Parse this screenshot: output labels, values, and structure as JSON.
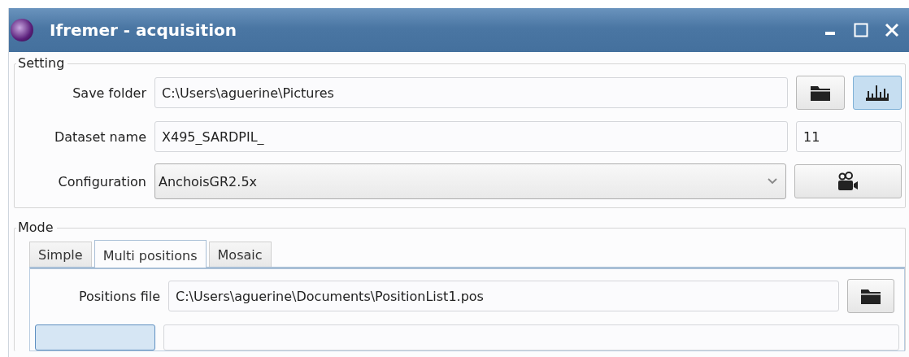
{
  "window": {
    "title": "Ifremer - acquisition"
  },
  "setting": {
    "label": "Setting",
    "rows": [
      {
        "kind": "folder",
        "label": "Save folder",
        "value": "C:\\Users\\aguerine\\Pictures",
        "toggle_checked": true
      },
      {
        "kind": "counter",
        "label": "Dataset name",
        "value": "X495_SARDPIL_",
        "count": "11"
      },
      {
        "kind": "combo",
        "label": "Configuration",
        "value": "AnchoisGR2.5x"
      }
    ]
  },
  "mode": {
    "label": "Mode",
    "tabs": [
      {
        "label": "Simple",
        "selected": false
      },
      {
        "label": "Multi positions",
        "selected": true
      },
      {
        "label": "Mosaic",
        "selected": false
      }
    ],
    "positions_file": {
      "label": "Positions file",
      "value": "C:\\Users\\aguerine\\Documents\\PositionList1.pos"
    }
  }
}
